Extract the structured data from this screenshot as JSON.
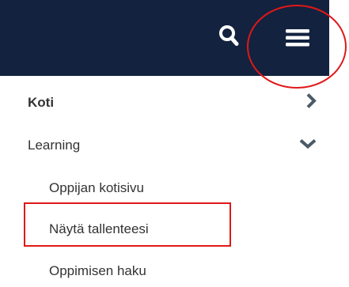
{
  "header": {
    "search_icon": "search-icon",
    "menu_icon": "hamburger-menu-icon",
    "background_color": "#13223f",
    "icon_color": "#ffffff"
  },
  "nav": {
    "items": [
      {
        "label": "Koti",
        "chevron": "chevron-right-icon",
        "bold": true
      },
      {
        "label": "Learning",
        "chevron": "chevron-down-icon",
        "expanded": true,
        "children": [
          {
            "label": "Oppijan kotisivu"
          },
          {
            "label": "Näytä tallenteesi"
          },
          {
            "label": "Oppimisen haku"
          }
        ]
      }
    ],
    "text_color": "#333333"
  },
  "annotations": {
    "highlight_color": "#e01818"
  }
}
